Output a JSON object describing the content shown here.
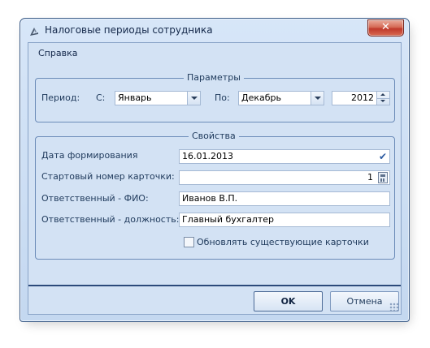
{
  "window": {
    "title": "Налоговые периоды сотрудника",
    "close_label": "✕"
  },
  "menu": {
    "help": "Справка"
  },
  "params": {
    "group_title": "Параметры",
    "period_label": "Период:",
    "from_label": "С:",
    "from_value": "Январь",
    "to_label": "По:",
    "to_value": "Декабрь",
    "year_value": "2012"
  },
  "props": {
    "group_title": "Свойства",
    "date_label": "Дата формирования",
    "date_value": "16.01.2013",
    "start_number_label": "Стартовый номер карточки:",
    "start_number_value": "1",
    "responsible_name_label": "Ответственный - ФИО:",
    "responsible_name_value": "Иванов В.П.",
    "responsible_position_label": "Ответственный - должность:",
    "responsible_position_value": "Главный бухгалтер",
    "update_cards_label": "Обновлять существующие карточки",
    "update_cards_checked": false
  },
  "buttons": {
    "ok": "OK",
    "cancel": "Отмена"
  },
  "icons": {
    "app": "window-app-icon",
    "close": "close-icon",
    "combo": "chevron-down-icon",
    "date": "checkmark-icon",
    "calc": "calculator-icon"
  }
}
